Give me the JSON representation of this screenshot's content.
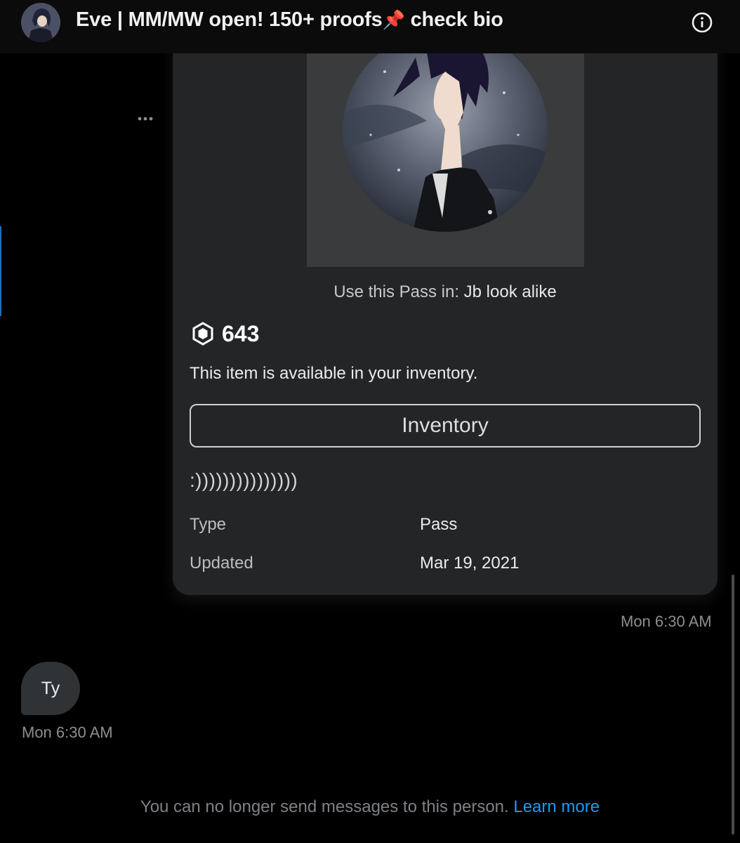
{
  "header": {
    "title": "Eve | MM/MW open! 150+ proofs",
    "title_emoji": "📌",
    "title_suffix": " check bio",
    "info_icon": "info-icon"
  },
  "message_card": {
    "more_icon": "more-horizontal-icon",
    "use_pass_prefix": "Use this Pass in: ",
    "use_pass_game": "Jb look alike",
    "currency_icon": "robux-icon",
    "price": "643",
    "availability": "This item is available in your inventory.",
    "inventory_button": "Inventory",
    "description": ":)))))))))))))))",
    "details": [
      {
        "label": "Type",
        "value": "Pass"
      },
      {
        "label": "Updated",
        "value": "Mar 19, 2021"
      }
    ],
    "timestamp": "Mon 6:30 AM"
  },
  "reply": {
    "text": "Ty",
    "timestamp": "Mon 6:30 AM"
  },
  "footer": {
    "notice": "You can no longer send messages to this person.",
    "learn_more": "Learn more"
  },
  "colors": {
    "background": "#000000",
    "card": "#232527",
    "link": "#1d9bf0",
    "bubble": "#2f3336"
  }
}
